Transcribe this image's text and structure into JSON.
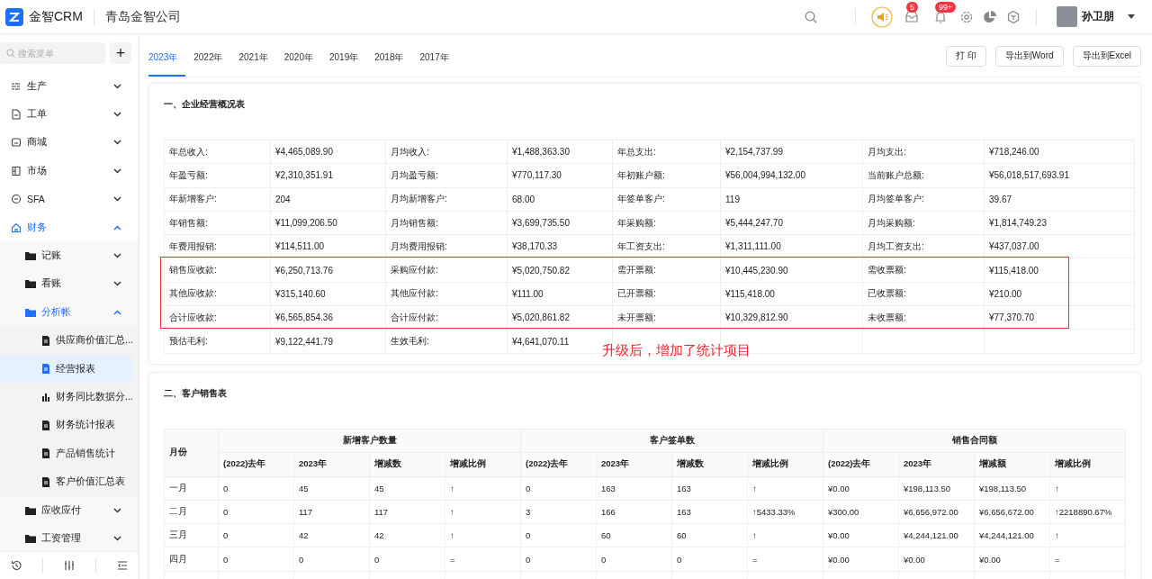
{
  "header": {
    "brand": "金智CRM",
    "company": "青岛金智公司",
    "badges": [
      {
        "count": "5"
      },
      {
        "count": "99+"
      }
    ],
    "user": "孙卫朋"
  },
  "sidebar": {
    "search": {
      "placeholder": "搜索菜单"
    },
    "add_button": "+",
    "items": [
      {
        "label": "生产",
        "expanded": false,
        "selected": false
      },
      {
        "label": "工单",
        "expanded": false,
        "selected": false
      },
      {
        "label": "商城",
        "expanded": false,
        "selected": false
      },
      {
        "label": "市场",
        "expanded": false,
        "selected": false
      },
      {
        "label": "SFA",
        "expanded": false,
        "selected": false
      },
      {
        "label": "财务",
        "expanded": true,
        "selected": true,
        "children": [
          {
            "label": "记账",
            "expanded": false,
            "selected": false
          },
          {
            "label": "看账",
            "expanded": false,
            "selected": false
          },
          {
            "label": "分析帐",
            "expanded": true,
            "selected": true,
            "children": [
              {
                "label": "供应商价值汇总...",
                "selected": false
              },
              {
                "label": "经营报表",
                "selected": true
              },
              {
                "label": "财务同比数据分...",
                "selected": false
              },
              {
                "label": "财务统计报表",
                "selected": false
              },
              {
                "label": "产品销售统计",
                "selected": false
              },
              {
                "label": "客户价值汇总表",
                "selected": false
              }
            ]
          },
          {
            "label": "应收应付",
            "expanded": false,
            "selected": false
          },
          {
            "label": "工资管理",
            "expanded": false,
            "selected": false
          }
        ]
      }
    ]
  },
  "tabs": [
    {
      "label": "2023年",
      "selected": true
    },
    {
      "label": "2022年",
      "selected": false
    },
    {
      "label": "2021年",
      "selected": false
    },
    {
      "label": "2020年",
      "selected": false
    },
    {
      "label": "2019年",
      "selected": false
    },
    {
      "label": "2018年",
      "selected": false
    },
    {
      "label": "2017年",
      "selected": false
    }
  ],
  "buttons": [
    "打 印",
    "导出到Word",
    "导出到Excel"
  ],
  "overview": {
    "title": "一、企业经营概况表",
    "annotation": "升级后，增加了统计项目",
    "rows": [
      {
        "kind": "row",
        "pairs": [
          [
            "年总收入:",
            "¥4,465,089.90"
          ],
          [
            "月均收入:",
            "¥1,488,363.30"
          ],
          [
            "年总支出:",
            "¥2,154,737.99"
          ],
          [
            "月均支出:",
            "¥718,246.00"
          ]
        ]
      },
      {
        "kind": "row",
        "pairs": [
          [
            "年盈亏额:",
            "¥2,310,351.91"
          ],
          [
            "月均盈亏额:",
            "¥770,117.30"
          ],
          [
            "年初账户额:",
            "¥56,004,994,132.00"
          ],
          [
            "当前账户总额:",
            "¥56,018,517,693.91"
          ]
        ]
      },
      {
        "kind": "row",
        "pairs": [
          [
            "年新增客户:",
            "204"
          ],
          [
            "月均新增客户:",
            "68.00"
          ],
          [
            "年签单客户:",
            "119"
          ],
          [
            "月均签单客户:",
            "39.67"
          ]
        ]
      },
      {
        "kind": "row",
        "pairs": [
          [
            "年销售额:",
            "¥11,099,206.50"
          ],
          [
            "月均销售额:",
            "¥3,699,735.50"
          ],
          [
            "年采购额:",
            "¥5,444,247.70"
          ],
          [
            "月均采购额:",
            "¥1,814,749.23"
          ]
        ]
      },
      {
        "kind": "row",
        "pairs": [
          [
            "年费用报销:",
            "¥114,511.00"
          ],
          [
            "月均费用报销:",
            "¥38,170.33"
          ],
          [
            "年工资支出:",
            "¥1,311,111.00"
          ],
          [
            "月均工资支出:",
            "¥437,037.00"
          ]
        ]
      },
      {
        "kind": "highlight_group",
        "rows": [
          {
            "pairs": [
              [
                "销售应收款:",
                "¥6,250,713.76"
              ],
              [
                "采购应付款:",
                "¥5,020,750.82"
              ],
              [
                "需开票额:",
                "¥10,445,230.90"
              ],
              [
                "需收票额:",
                "¥115,418.00"
              ]
            ]
          },
          {
            "pairs": [
              [
                "其他应收款:",
                "¥315,140.60"
              ],
              [
                "其他应付款:",
                "¥111.00"
              ],
              [
                "已开票额:",
                "¥115,418.00"
              ],
              [
                "已收票额:",
                "¥210.00"
              ]
            ]
          },
          {
            "pairs": [
              [
                "合计应收款:",
                "¥6,565,854.36"
              ],
              [
                "合计应付款:",
                "¥5,020,861.82"
              ],
              [
                "未开票额:",
                "¥10,329,812.90"
              ],
              [
                "未收票额:",
                "¥77,370.70"
              ]
            ]
          }
        ]
      },
      {
        "kind": "row",
        "pairs": [
          [
            "预估毛利:",
            "¥9,122,441.79"
          ],
          [
            "生效毛利:",
            "¥4,641,070.11"
          ]
        ]
      }
    ]
  },
  "sales": {
    "title": "二、客户销售表",
    "month_header": "月份",
    "groups": [
      {
        "title": "新增客户数量",
        "columns": [
          "(2022)去年",
          "2023年",
          "增减数",
          "增减比例"
        ]
      },
      {
        "title": "客户签单数",
        "columns": [
          "(2022)去年",
          "2023年",
          "增减数",
          "增减比例"
        ]
      },
      {
        "title": "销售合同额",
        "columns": [
          "(2022)去年",
          "2023年",
          "增减额",
          "增减比例"
        ]
      }
    ],
    "rows": [
      {
        "month": "一月",
        "cells": [
          "0",
          "45",
          "45",
          "↑",
          "0",
          "163",
          "163",
          "↑",
          "¥0.00",
          "¥198,113.50",
          "¥198,113.50",
          "↑"
        ]
      },
      {
        "month": "二月",
        "cells": [
          "0",
          "117",
          "117",
          "↑",
          "3",
          "166",
          "163",
          "↑5433.33%",
          "¥300.00",
          "¥6,656,972.00",
          "¥6,656,672.00",
          "↑2218890.67%"
        ]
      },
      {
        "month": "三月",
        "cells": [
          "0",
          "42",
          "42",
          "↑",
          "0",
          "60",
          "60",
          "↑",
          "¥0.00",
          "¥4,244,121.00",
          "¥4,244,121.00",
          "↑"
        ]
      },
      {
        "month": "四月",
        "cells": [
          "0",
          "0",
          "0",
          "=",
          "0",
          "0",
          "0",
          "=",
          "¥0.00",
          "¥0.00",
          "¥0.00",
          "="
        ]
      }
    ]
  }
}
